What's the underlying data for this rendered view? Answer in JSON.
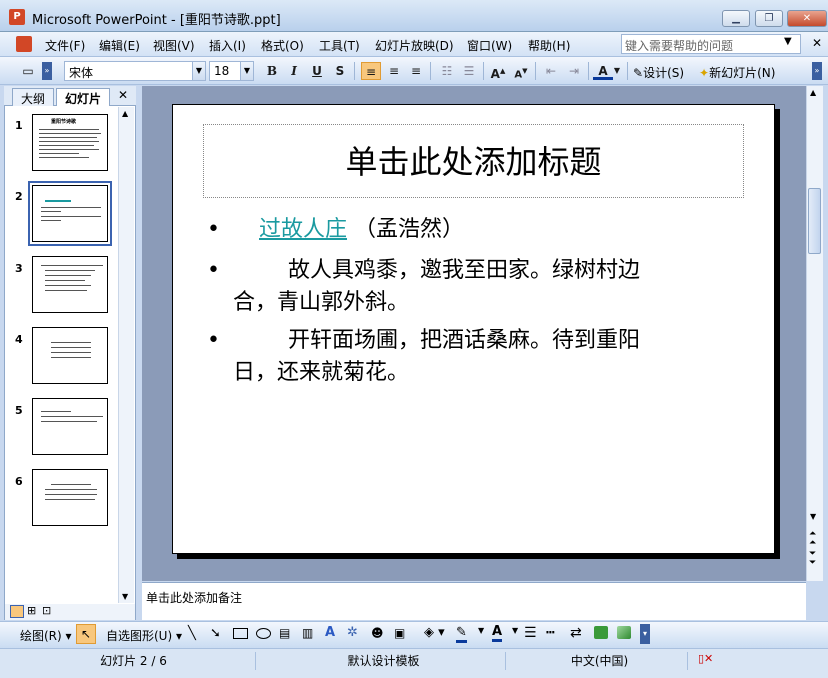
{
  "window": {
    "title": "Microsoft PowerPoint - [重阳节诗歌.ppt]",
    "app_icon": "P"
  },
  "menu": {
    "items": [
      "文件(F)",
      "编辑(E)",
      "视图(V)",
      "插入(I)",
      "格式(O)",
      "工具(T)",
      "幻灯片放映(D)",
      "窗口(W)",
      "帮助(H)"
    ],
    "help_placeholder": "键入需要帮助的问题"
  },
  "toolbar": {
    "font": "宋体",
    "size": "18",
    "design_label": "设计(S)",
    "new_slide_label": "新幻灯片(N)"
  },
  "left_pane": {
    "tabs": [
      "大纲",
      "幻灯片"
    ],
    "slides": [
      {
        "number": "1",
        "title": "重阳节诗歌"
      },
      {
        "number": "2"
      },
      {
        "number": "3"
      },
      {
        "number": "4"
      },
      {
        "number": "5"
      },
      {
        "number": "6"
      }
    ],
    "selected_slide": 2
  },
  "slide": {
    "title_placeholder": "单击此处添加标题",
    "bullets": [
      {
        "link": "过故人庄",
        "text": "（孟浩然）"
      },
      {
        "line1": "故人具鸡黍，邀我至田家。绿树村边",
        "line2": "合，青山郭外斜。"
      },
      {
        "line1": "开轩面场圃，把酒话桑麻。待到重阳",
        "line2": "日，还来就菊花。"
      }
    ]
  },
  "notes_placeholder": "单击此处添加备注",
  "draw_toolbar": {
    "draw_label": "绘图(R)",
    "autoshape_label": "自选图形(U)"
  },
  "status": {
    "slide": "幻灯片 2 / 6",
    "template": "默认设计模板",
    "language": "中文(中国)"
  },
  "colors": {
    "accent": "#d24726",
    "link": "#1a9aa0",
    "selection": "#3b63b0"
  }
}
